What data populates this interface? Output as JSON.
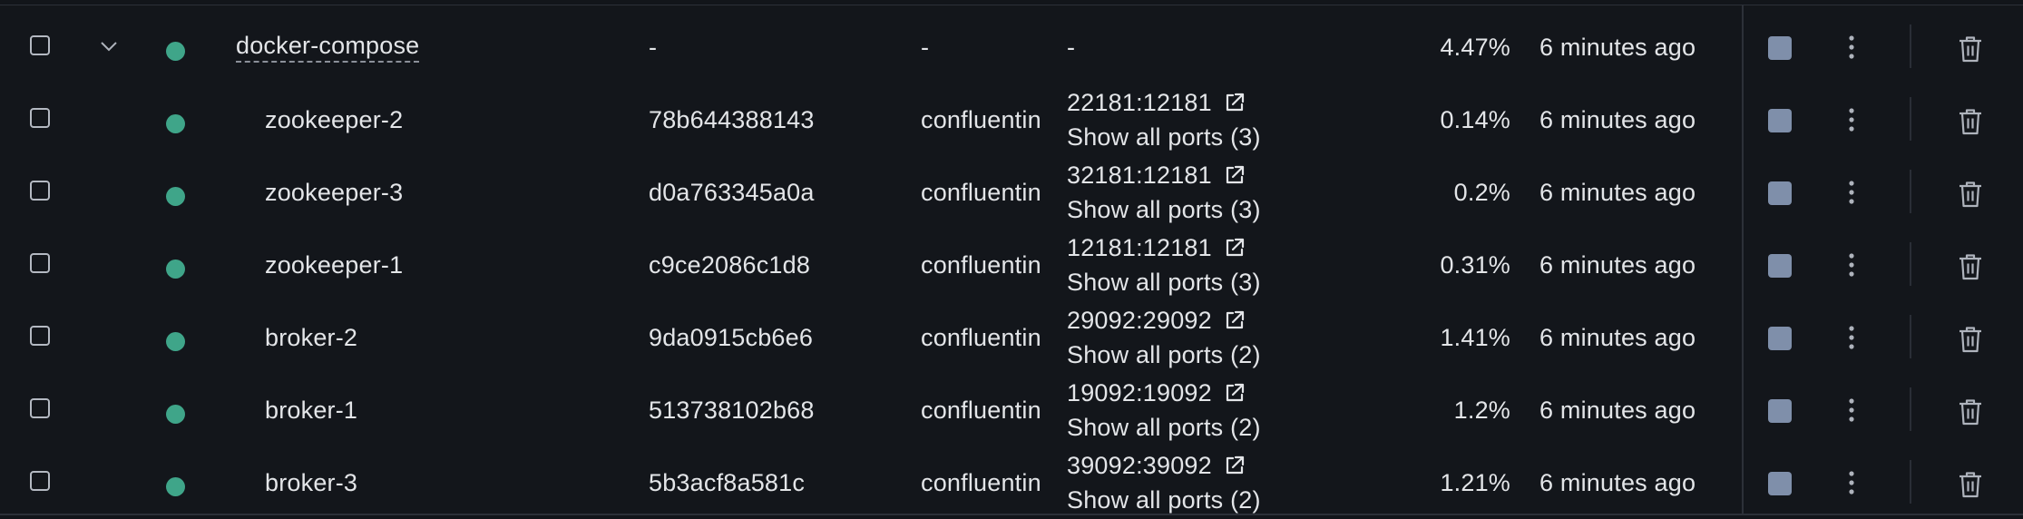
{
  "colors": {
    "background": "#13161b",
    "text": "#e3e5e8",
    "status_running": "#3fa589",
    "stop_button": "#7f8faa",
    "icon": "#aeb3bc"
  },
  "icons": {
    "expand": "chevron-down-icon",
    "status": "status-dot",
    "external_link": "external-link-icon",
    "stop": "stop-icon",
    "menu": "kebab-menu-icon",
    "delete": "trash-icon"
  },
  "rows": [
    {
      "name": "docker-compose",
      "id": "-",
      "image": "-",
      "port": "-",
      "show_ports": "",
      "cpu": "4.47%",
      "started": "6 minutes ago"
    },
    {
      "name": "zookeeper-2",
      "id": "78b644388143",
      "image": "confluentin",
      "port": "22181:12181",
      "show_ports": "Show all ports (3)",
      "cpu": "0.14%",
      "started": "6 minutes ago"
    },
    {
      "name": "zookeeper-3",
      "id": "d0a763345a0a",
      "image": "confluentin",
      "port": "32181:12181",
      "show_ports": "Show all ports (3)",
      "cpu": "0.2%",
      "started": "6 minutes ago"
    },
    {
      "name": "zookeeper-1",
      "id": "c9ce2086c1d8",
      "image": "confluentin",
      "port": "12181:12181",
      "show_ports": "Show all ports (3)",
      "cpu": "0.31%",
      "started": "6 minutes ago"
    },
    {
      "name": "broker-2",
      "id": "9da0915cb6e6",
      "image": "confluentin",
      "port": "29092:29092",
      "show_ports": "Show all ports (2)",
      "cpu": "1.41%",
      "started": "6 minutes ago"
    },
    {
      "name": "broker-1",
      "id": "513738102b68",
      "image": "confluentin",
      "port": "19092:19092",
      "show_ports": "Show all ports (2)",
      "cpu": "1.2%",
      "started": "6 minutes ago"
    },
    {
      "name": "broker-3",
      "id": "5b3acf8a581c",
      "image": "confluentin",
      "port": "39092:39092",
      "show_ports": "Show all ports (2)",
      "cpu": "1.21%",
      "started": "6 minutes ago"
    }
  ]
}
